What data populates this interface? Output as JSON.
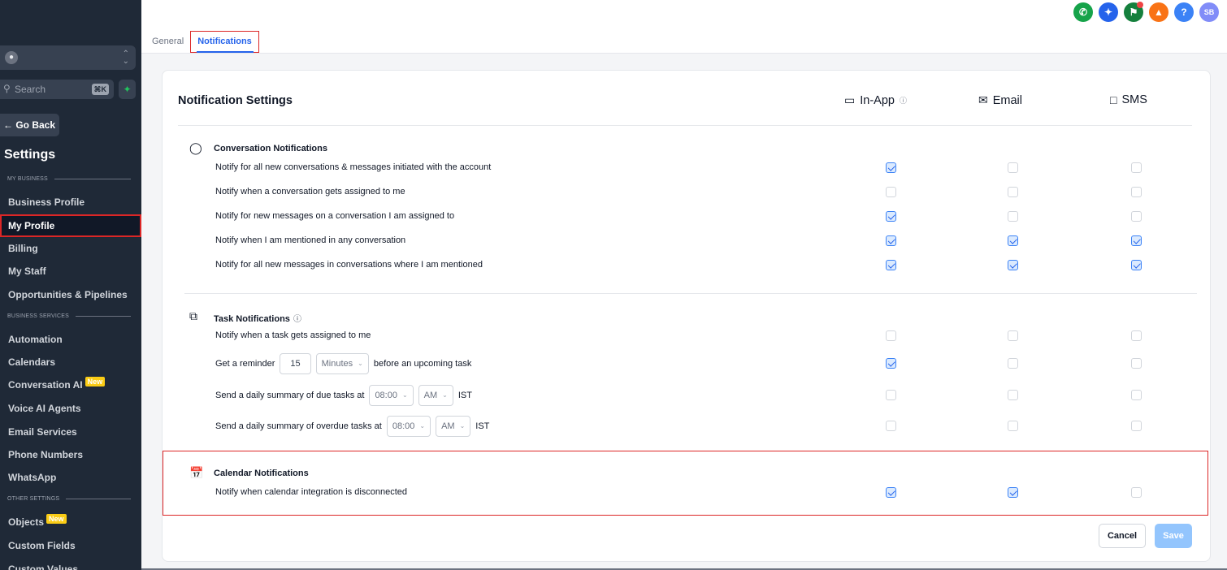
{
  "sidebar": {
    "search_placeholder": "Search",
    "search_shortcut": "⌘K",
    "go_back": "← Go Back",
    "title": "Settings",
    "sections": {
      "my_business": "MY BUSINESS",
      "business_services": "BUSINESS SERVICES",
      "other_settings": "OTHER SETTINGS"
    },
    "items": {
      "business_profile": "Business Profile",
      "my_profile": "My Profile",
      "billing": "Billing",
      "my_staff": "My Staff",
      "opportunities": "Opportunities & Pipelines",
      "automation": "Automation",
      "calendars": "Calendars",
      "conversation_ai": "Conversation AI",
      "voice_ai": "Voice AI Agents",
      "email_services": "Email Services",
      "phone_numbers": "Phone Numbers",
      "whatsapp": "WhatsApp",
      "objects": "Objects",
      "custom_fields": "Custom Fields",
      "custom_values": "Custom Values"
    },
    "new_badge": "New"
  },
  "topbar": {
    "tabs": {
      "general": "General",
      "notifications": "Notifications"
    },
    "user_initials": "SB",
    "help": "?"
  },
  "card": {
    "title": "Notification Settings",
    "columns": {
      "in_app": "In-App",
      "email": "Email",
      "sms": "SMS"
    },
    "groups": {
      "conversation": {
        "title": "Conversation Notifications",
        "rows": [
          {
            "label": "Notify for all new conversations & messages initiated with the account",
            "in_app": true,
            "email": false,
            "sms": false
          },
          {
            "label": "Notify when a conversation gets assigned to me",
            "in_app": false,
            "email": false,
            "sms": false
          },
          {
            "label": "Notify for new messages on a conversation I am assigned to",
            "in_app": true,
            "email": false,
            "sms": false
          },
          {
            "label": "Notify when I am mentioned in any conversation",
            "in_app": true,
            "email": true,
            "sms": true
          },
          {
            "label": "Notify for all new messages in conversations where I am mentioned",
            "in_app": true,
            "email": true,
            "sms": true
          }
        ]
      },
      "task": {
        "title": "Task Notifications",
        "row1": "Notify when a task gets assigned to me",
        "row2_a": "Get a reminder",
        "row2_value": "15",
        "row2_unit": "Minutes",
        "row2_b": "before an upcoming task",
        "row3_a": "Send a daily summary of due tasks at",
        "row3_time": "08:00",
        "row3_ampm": "AM",
        "row3_tz": "IST",
        "row4_a": "Send a daily summary of overdue tasks at",
        "row4_time": "08:00",
        "row4_ampm": "AM",
        "row4_tz": "IST",
        "checks": [
          {
            "in_app": false,
            "email": false,
            "sms": false
          },
          {
            "in_app": true,
            "email": false,
            "sms": false
          },
          {
            "in_app": false,
            "email": false,
            "sms": false
          },
          {
            "in_app": false,
            "email": false,
            "sms": false
          }
        ]
      },
      "calendar": {
        "title": "Calendar Notifications",
        "rows": [
          {
            "label": "Notify when calendar integration is disconnected",
            "in_app": true,
            "email": true,
            "sms": false
          }
        ]
      }
    },
    "buttons": {
      "cancel": "Cancel",
      "save": "Save"
    }
  },
  "colors": {
    "accent": "#2563eb",
    "highlight": "#dc2626",
    "sidebar": "#1f2937"
  }
}
